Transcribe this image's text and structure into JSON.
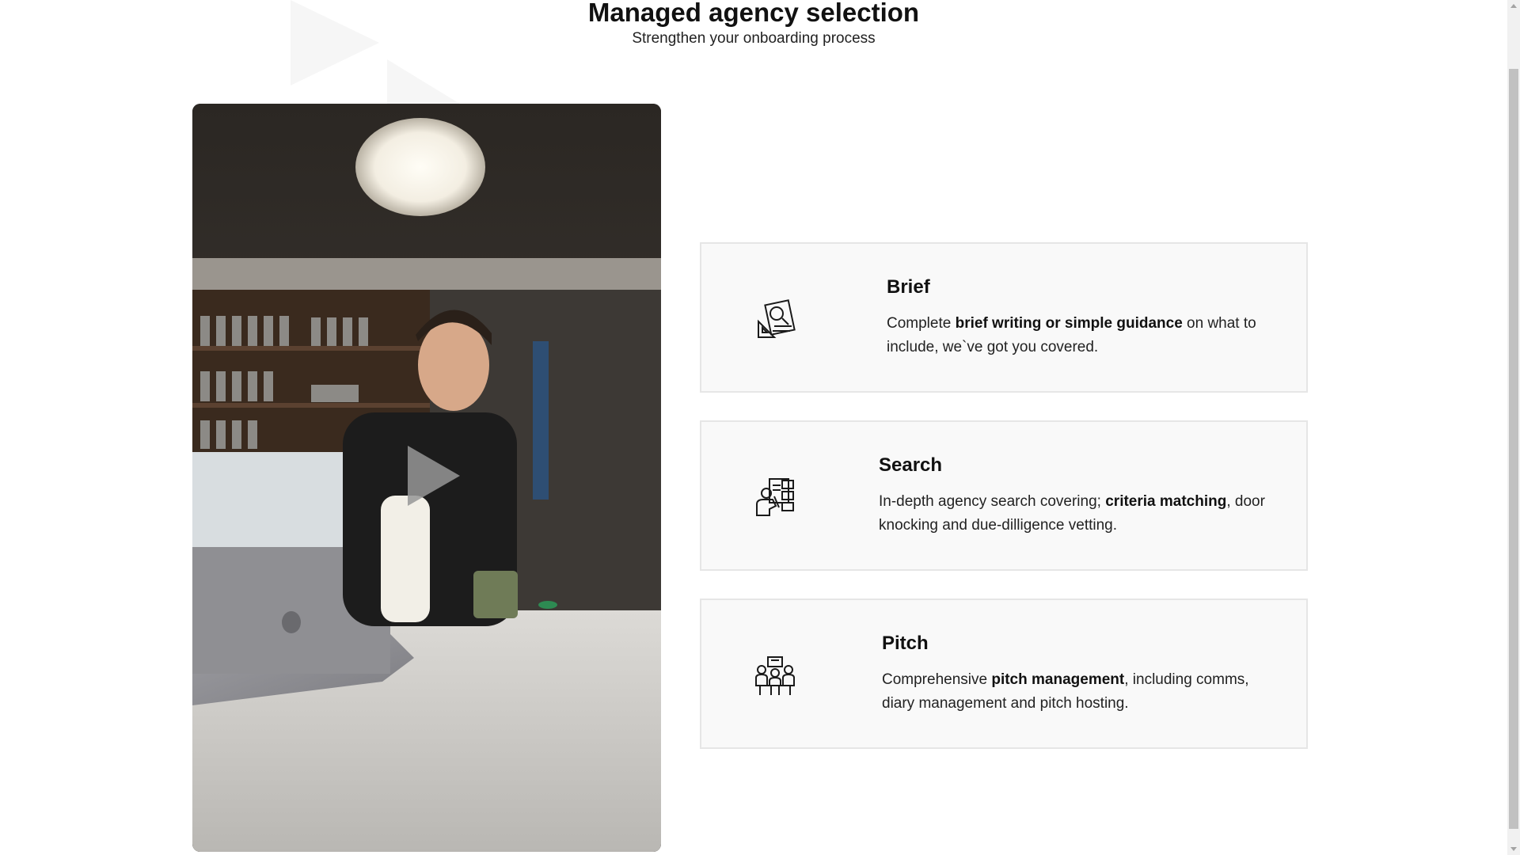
{
  "header": {
    "title": "Managed agency selection",
    "subtitle": "Strengthen your onboarding process"
  },
  "video": {
    "play_icon": "play-icon"
  },
  "cards": [
    {
      "title": "Brief",
      "icon": "brief-icon",
      "desc_pre": "Complete ",
      "desc_bold": "brief writing or simple guidance",
      "desc_post": " on what to include, we`ve got you covered."
    },
    {
      "title": "Search",
      "icon": "search-icon",
      "desc_pre": "In-depth agency search covering; ",
      "desc_bold": "criteria matching",
      "desc_post": ", door knocking and due-dilligence vetting."
    },
    {
      "title": "Pitch",
      "icon": "pitch-icon",
      "desc_pre": "Comprehensive ",
      "desc_bold": "pitch management",
      "desc_post": ", including comms, diary management and pitch hosting."
    }
  ],
  "colors": {
    "card_background": "#f9f9f9",
    "card_border": "#e6e6e6",
    "text": "#111111"
  }
}
